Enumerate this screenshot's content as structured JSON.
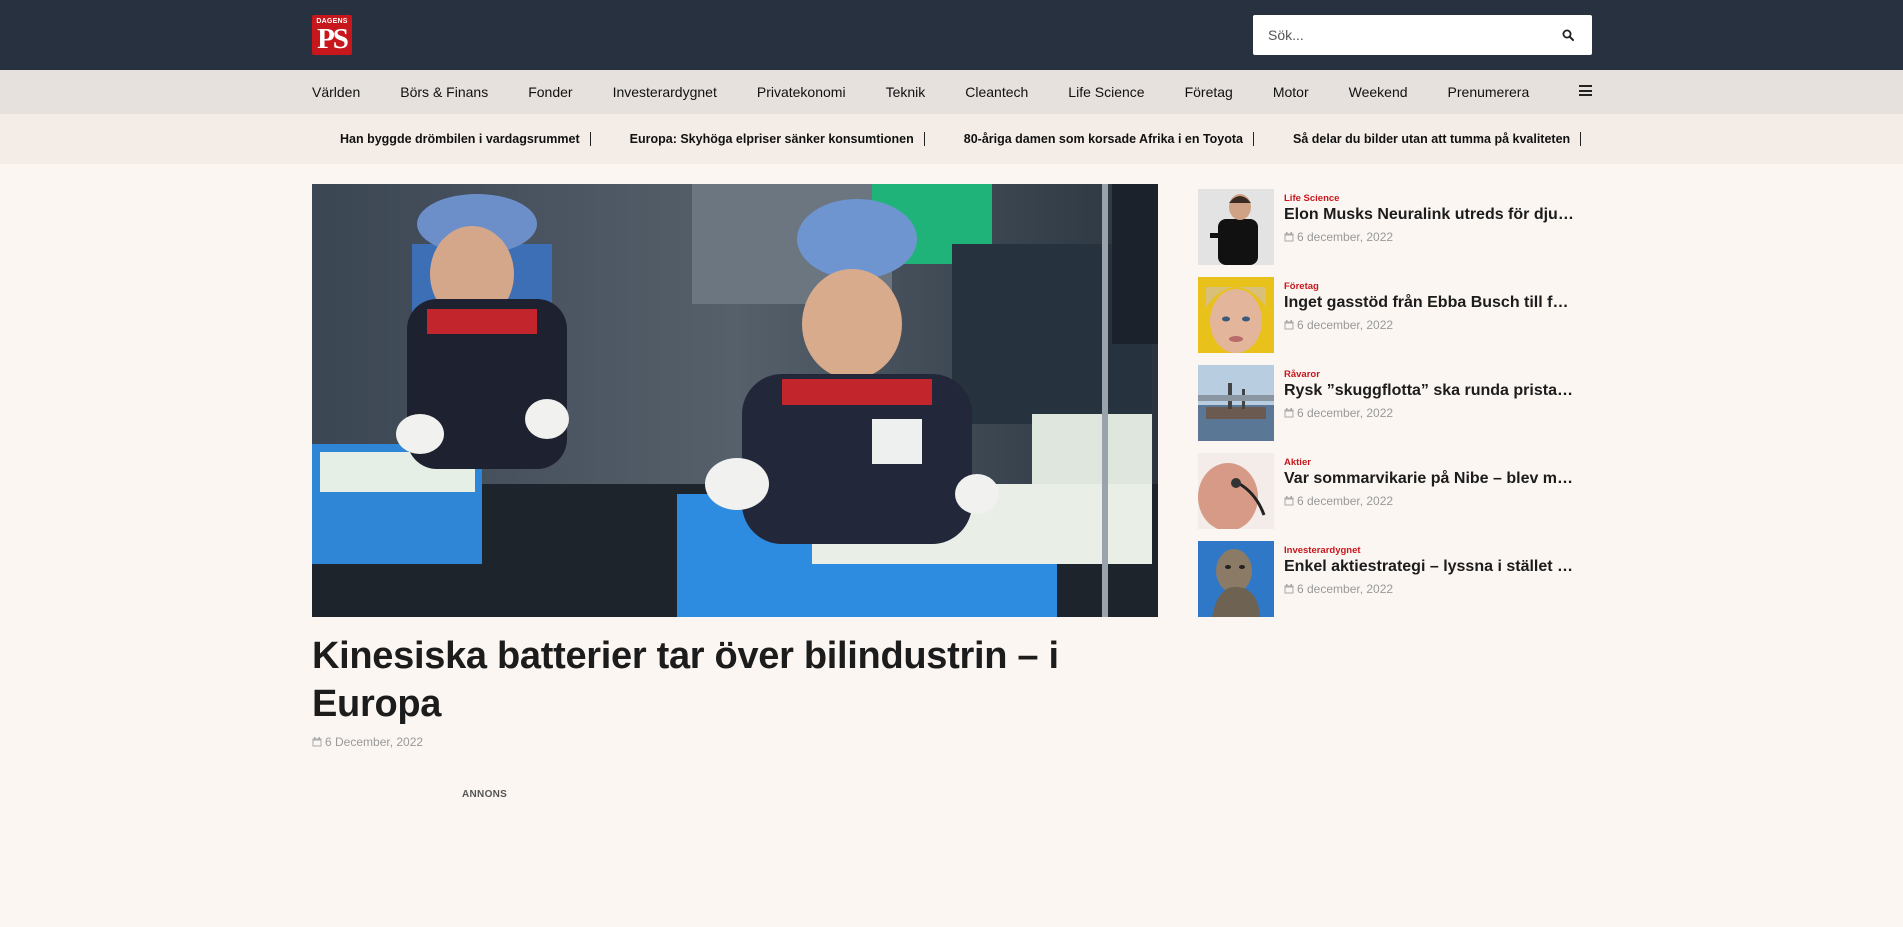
{
  "brand": {
    "logo_top": "DAGENS",
    "logo_main": "PS"
  },
  "search": {
    "placeholder": "Sök..."
  },
  "nav": {
    "items": [
      "Världen",
      "Börs & Finans",
      "Fonder",
      "Investerardygnet",
      "Privatekonomi",
      "Teknik",
      "Cleantech",
      "Life Science",
      "Företag",
      "Motor",
      "Weekend",
      "Prenumerera"
    ],
    "menu_icon": "hamburger-menu-icon"
  },
  "ticker": {
    "items": [
      "Han byggde drömbilen i vardagsrummet",
      "Europa: Skyhöga elpriser sänker konsumtionen",
      "80-åriga damen som korsade Afrika i en Toyota",
      "Så delar du bilder utan att tumma på kvaliteten"
    ]
  },
  "main_article": {
    "title": "Kinesiska batterier tar över bilindustrin – i Europa",
    "date": "6 December, 2022",
    "image_description_icon": "factory-workers-photo"
  },
  "ad": {
    "label": "ANNONS"
  },
  "sidebar": {
    "items": [
      {
        "category": "Life Science",
        "title": "Elon Musks Neuralink utreds för djurs...",
        "date": "6 december, 2022"
      },
      {
        "category": "Företag",
        "title": "Inget gasstöd från Ebba Busch till före...",
        "date": "6 december, 2022"
      },
      {
        "category": "Råvaror",
        "title": "Rysk ”skuggflotta” ska runda pristake...",
        "date": "6 december, 2022"
      },
      {
        "category": "Aktier",
        "title": "Var sommarvikarie på Nibe – blev milj...",
        "date": "6 december, 2022"
      },
      {
        "category": "Investerardygnet",
        "title": "Enkel aktiestrategi – lyssna i stället fö...",
        "date": "6 december, 2022"
      }
    ]
  },
  "colors": {
    "topbar": "#273140",
    "nav": "#e7e1dd",
    "ticker": "#f4ede7",
    "accent": "#c8161d",
    "background": "#fbf6f2"
  }
}
